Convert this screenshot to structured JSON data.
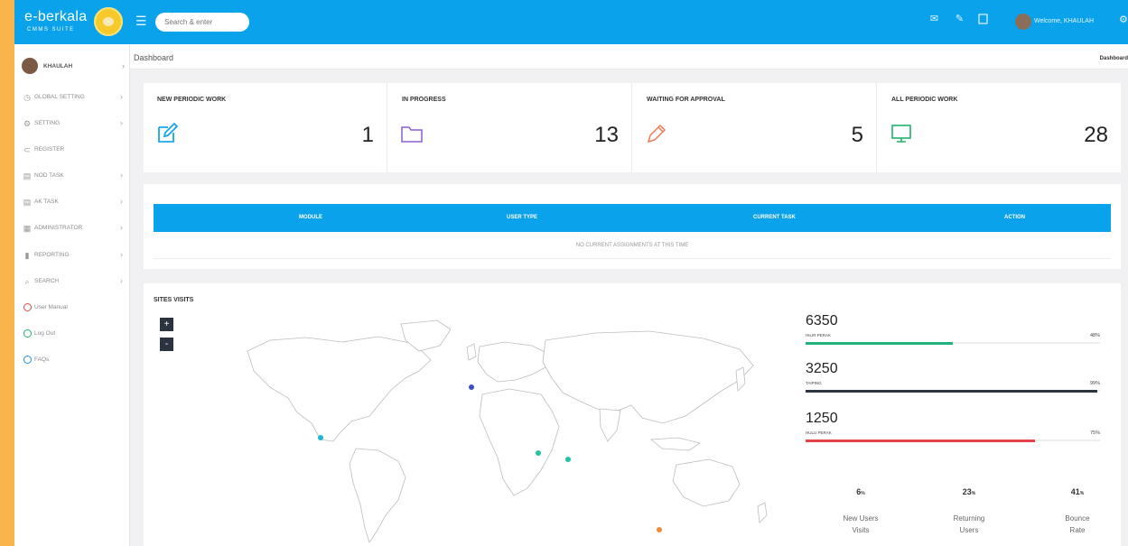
{
  "brand": {
    "name": "e-berkala",
    "sub": "CMMS SUITE"
  },
  "header": {
    "search_placeholder": "Search & enter",
    "welcome": "Welcome, KHAULAH"
  },
  "sidebar": {
    "user": "KHAULAH",
    "items": [
      {
        "label": "GLOBAL SETTING",
        "icon": "clock-icon"
      },
      {
        "label": "SETTING",
        "icon": "gear-icon"
      },
      {
        "label": "REGISTER",
        "icon": "register-icon"
      },
      {
        "label": "NOD TASK",
        "icon": "calendar-icon"
      },
      {
        "label": "AK TASK",
        "icon": "calendar-icon"
      },
      {
        "label": "ADMINISTRATOR",
        "icon": "grid-icon"
      },
      {
        "label": "REPORTING",
        "icon": "bar-chart-icon"
      },
      {
        "label": "SEARCH",
        "icon": "search-icon"
      },
      {
        "label": "User Manual",
        "icon": "ring-icon",
        "color": "#e24b4b"
      },
      {
        "label": "Log Out",
        "icon": "ring-icon",
        "color": "#1fb36b"
      },
      {
        "label": "FAQs",
        "icon": "ring-icon",
        "color": "#1a8fe0"
      }
    ]
  },
  "breadcrumb": {
    "title": "Dashboard",
    "right": "Dashboard"
  },
  "stats": [
    {
      "title": "NEW PERIODIC WORK",
      "value": "1",
      "icon": "edit-icon",
      "color": "#1aa6e8"
    },
    {
      "title": "IN PROGRESS",
      "value": "13",
      "icon": "folder-icon",
      "color": "#8a5fd0"
    },
    {
      "title": "WAITING FOR APPROVAL",
      "value": "5",
      "icon": "pencil-icon",
      "color": "#ef7a55"
    },
    {
      "title": "ALL PERIODIC WORK",
      "value": "28",
      "icon": "monitor-icon",
      "color": "#1fb36b"
    }
  ],
  "task_table": {
    "columns": [
      "MODULE",
      "USER TYPE",
      "CURRENT TASK",
      "ACTION"
    ],
    "empty": "NO CURRENT ASSIGNMENTS AT THIS TIME"
  },
  "site_visits": {
    "title": "SITES VISITS",
    "zoom_in": "+",
    "zoom_out": "-",
    "metrics": [
      {
        "value": "6350",
        "label": "HILIR PERAK",
        "percent": "48%",
        "fill": 0.5,
        "color": "#1fb37e"
      },
      {
        "value": "3250",
        "label": "TAIPING",
        "percent": "99%",
        "fill": 0.99,
        "color": "#2d3540"
      },
      {
        "value": "1250",
        "label": "HULU PERAK",
        "percent": "75%",
        "fill": 0.78,
        "color": "#e5434b"
      }
    ],
    "summary": [
      {
        "value": "6",
        "unit": "%",
        "label1": "New Users",
        "label2": "Visits"
      },
      {
        "value": "23",
        "unit": "%",
        "label1": "Returning",
        "label2": "Users"
      },
      {
        "value": "41",
        "unit": "%",
        "label1": "Bounce",
        "label2": "Rate"
      }
    ]
  }
}
